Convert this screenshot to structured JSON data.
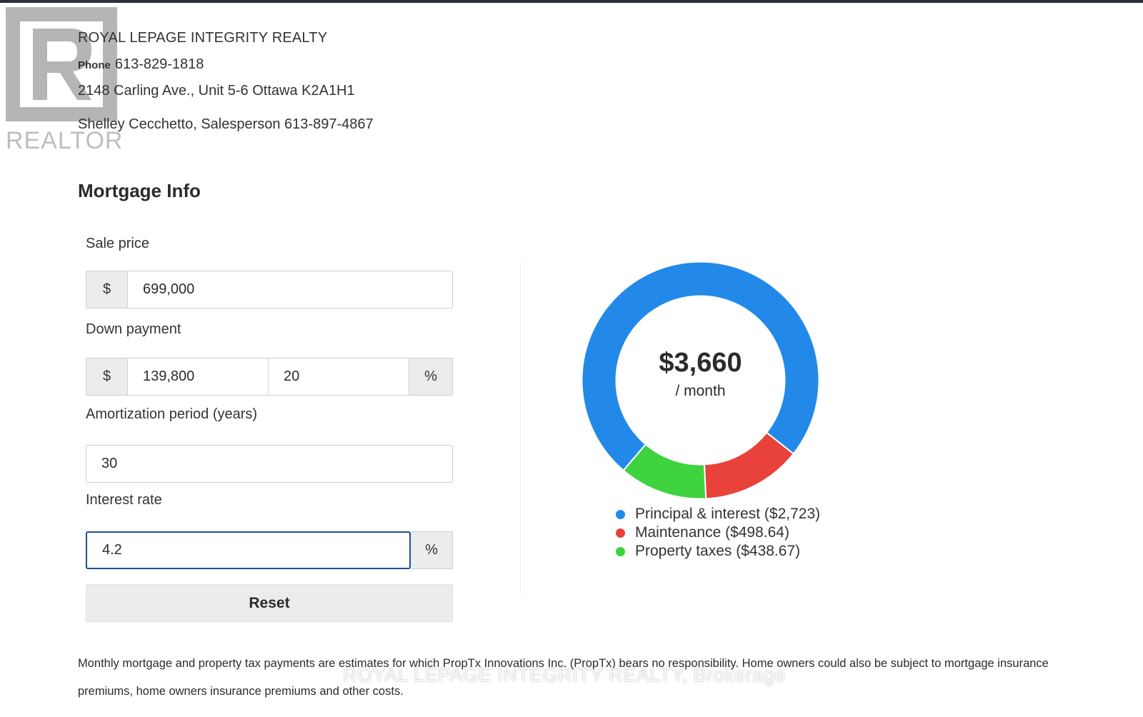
{
  "logo": {
    "word": "REALTOR",
    "icon": "realtor-r-icon"
  },
  "header": {
    "brokerage": "ROYAL LEPAGE INTEGRITY REALTY",
    "phone_label": "Phone",
    "phone": "613-829-1818",
    "address": "2148 Carling Ave., Unit 5-6 Ottawa K2A1H1",
    "agent": "Shelley Cecchetto, Salesperson 613-897-4867"
  },
  "mortgage": {
    "title": "Mortgage Info",
    "sale_price": {
      "label": "Sale price",
      "currency": "$",
      "value": "699,000"
    },
    "down_payment": {
      "label": "Down payment",
      "currency": "$",
      "amount": "139,800",
      "percent": "20",
      "percent_sign": "%"
    },
    "amortization": {
      "label": "Amortization period (years)",
      "value": "30"
    },
    "interest_rate": {
      "label": "Interest rate",
      "value": "4.2",
      "percent_sign": "%"
    },
    "reset_label": "Reset"
  },
  "summary": {
    "total": "$3,660",
    "period": "/ month",
    "legend": [
      {
        "label": "Principal & interest ($2,723)",
        "color": "#2389e8"
      },
      {
        "label": "Maintenance ($498.64)",
        "color": "#e8423a"
      },
      {
        "label": "Property taxes ($438.67)",
        "color": "#3ed33f"
      }
    ]
  },
  "chart_data": {
    "type": "pie",
    "categories": [
      "Principal & interest",
      "Maintenance",
      "Property taxes"
    ],
    "values": [
      2723,
      498.64,
      438.67
    ],
    "colors": [
      "#2389e8",
      "#e8423a",
      "#3ed33f"
    ],
    "title": "",
    "center_label": "$3,660"
  },
  "footer": {
    "disclaimer": "Monthly mortgage and property tax payments are estimates for which PropTx Innovations Inc. (PropTx) bears no responsibility. Home owners could also be subject to mortgage insurance premiums, home owners insurance premiums and other costs.",
    "watermark": "ROYAL LEPAGE INTEGRITY REALTY, Brokerage"
  }
}
